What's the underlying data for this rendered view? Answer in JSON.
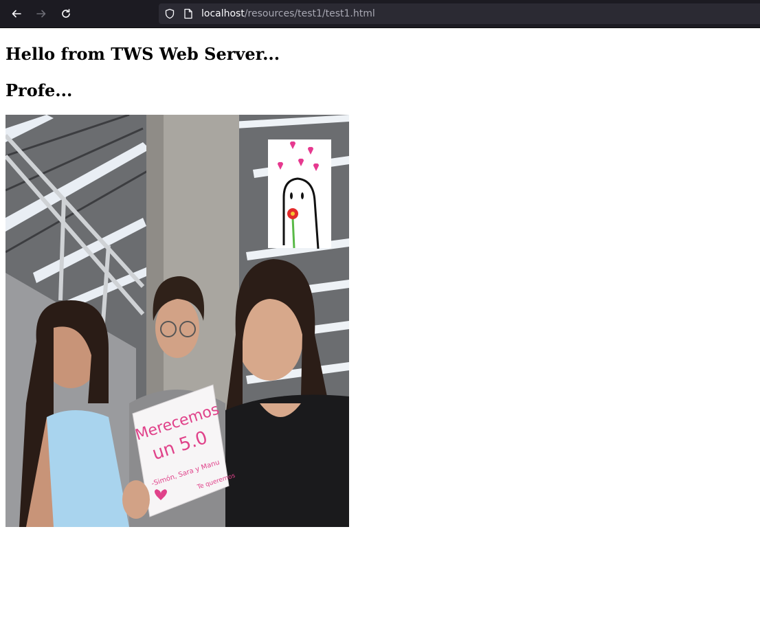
{
  "browser": {
    "url_host": "localhost",
    "url_path": "/resources/test1/test1.html",
    "back_icon": "arrow-left-icon",
    "forward_icon": "arrow-right-icon",
    "reload_icon": "reload-icon",
    "security_icon": "shield-icon",
    "page_icon": "page-icon"
  },
  "page": {
    "heading1": "Hello from TWS Web Server...",
    "heading2": "Profe..."
  },
  "photo": {
    "sign_line1": "Merecemos",
    "sign_line2": "un 5.0",
    "sign_signature": "-Simón, Sara y Manu",
    "sign_note": "Te queremos",
    "sticker": "heart-sticker"
  }
}
